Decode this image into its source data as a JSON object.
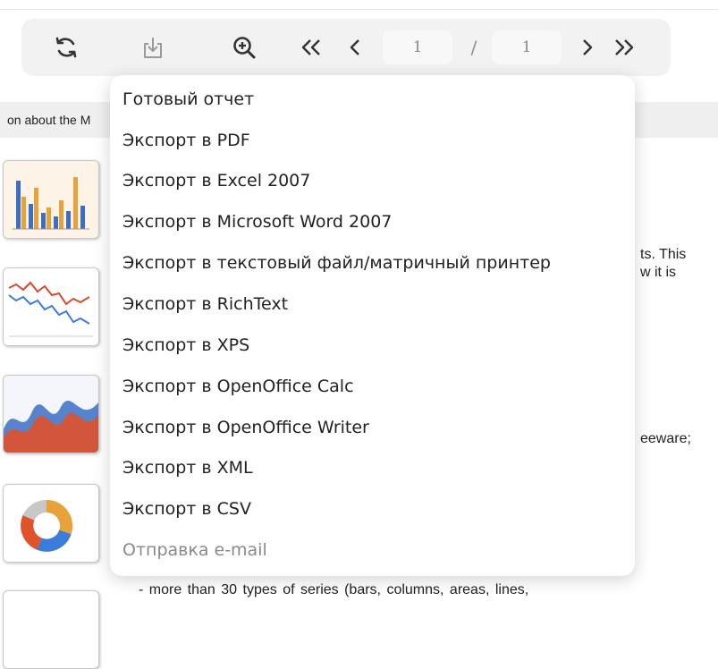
{
  "toolbar": {
    "refresh_icon": "refresh-icon",
    "export_icon": "download-icon",
    "zoom_icon": "zoom-in-icon",
    "first_icon": "first-page-icon",
    "prev_icon": "prev-page-icon",
    "next_icon": "next-page-icon",
    "last_icon": "last-page-icon",
    "current_page": "1",
    "separator": "/",
    "total_pages": "1"
  },
  "export_menu": {
    "items": [
      {
        "label": "Готовый отчет",
        "enabled": true
      },
      {
        "label": "Экспорт в PDF",
        "enabled": true
      },
      {
        "label": "Экспорт в Excel 2007",
        "enabled": true
      },
      {
        "label": "Экспорт в Microsoft Word 2007",
        "enabled": true
      },
      {
        "label": "Экспорт в текстовый файл/матричный принтер",
        "enabled": true
      },
      {
        "label": "Экспорт в RichText",
        "enabled": true
      },
      {
        "label": "Экспорт в XPS",
        "enabled": true
      },
      {
        "label": "Экспорт в OpenOffice Calc",
        "enabled": true
      },
      {
        "label": "Экспорт в OpenOffice Writer",
        "enabled": true
      },
      {
        "label": "Экспорт в XML",
        "enabled": true
      },
      {
        "label": "Экспорт в CSV",
        "enabled": true
      },
      {
        "label": "Отправка e-mail",
        "enabled": false
      }
    ]
  },
  "document": {
    "header_text": "on about the M",
    "fragment_1": "ts. This",
    "fragment_2": "w  it  is",
    "fragment_3": "eeware;",
    "bottom_line": "- more  than  30  types  of  series  (bars,  columns,  areas,  lines,"
  },
  "colors": {
    "toolbar_bg": "#f2f2f2",
    "icon": "#333333",
    "icon_disabled": "#9a9a9a",
    "menu_text": "#222222",
    "menu_disabled": "#8a8a8a"
  }
}
